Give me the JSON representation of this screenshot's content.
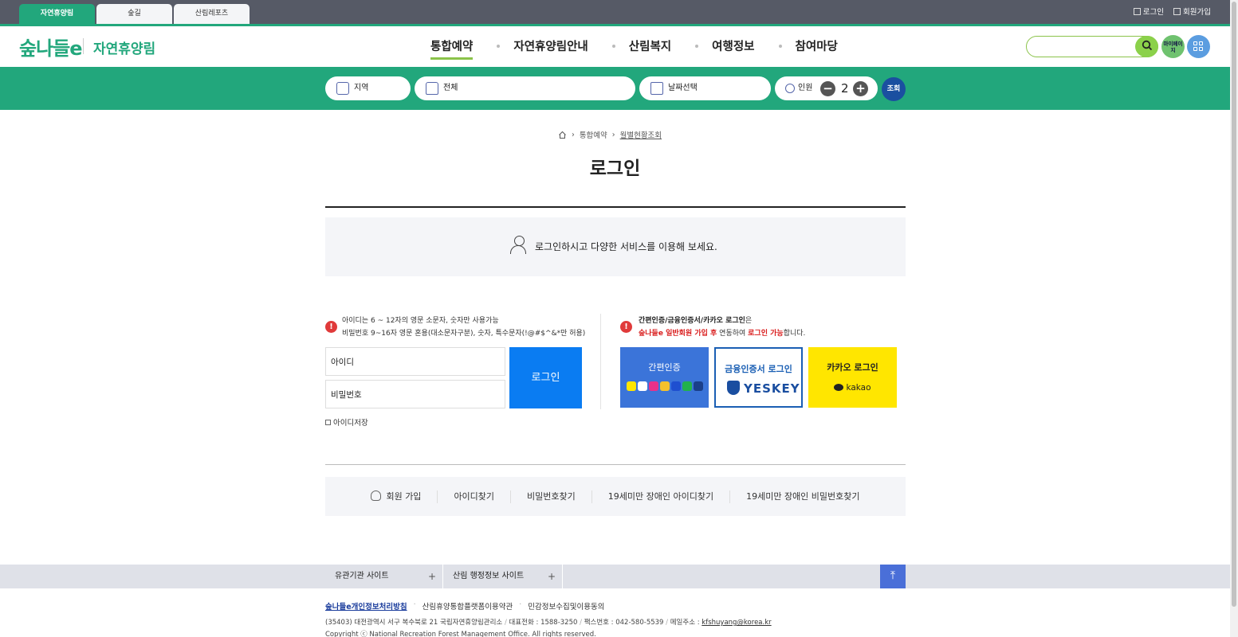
{
  "topbar": {
    "tabs": [
      "자연휴양림",
      "숲길",
      "산림레포츠"
    ],
    "login": "로그인",
    "join": "회원가입"
  },
  "header": {
    "logo": "숲나들e",
    "site_name": "자연휴양림",
    "nav": [
      "통합예약",
      "자연휴양림안내",
      "산림복지",
      "여행정보",
      "참여마당"
    ],
    "search_placeholder": "",
    "mypage": "마이페이지"
  },
  "searchbar": {
    "region": "지역",
    "facility": "전체",
    "date": "날짜선택",
    "people_label": "인원",
    "people_count": "2",
    "submit": "조회"
  },
  "breadcrumb": [
    "통합예약",
    "월별현황조회"
  ],
  "page_title": "로그인",
  "notice": "로그인하시고 다양한 서비스를 이용해 보세요.",
  "login_info": {
    "line1": "아이디는 6 ~ 12자의 영문 소문자, 숫자만 사용가능",
    "line2": "비밀번호 9~16자 영문 혼용(대소문자구분), 숫자, 특수문자(!@#$^&*만 허용)"
  },
  "easy_info": {
    "bold1": "간편인증/금융인증서/카카오 로그인",
    "text1": "은",
    "red1": "숲나들e 일반회원 가입 후",
    "text2": " 연동하여 ",
    "red2": "로그인 가능",
    "text3": "합니다."
  },
  "form": {
    "id_placeholder": "아이디",
    "pw_placeholder": "비밀번호",
    "login_button": "로그인",
    "save_id": "아이디저장"
  },
  "easy_login": {
    "simple": "간편인증",
    "cert": "금융인증서 로그인",
    "yeskey": "YESKEY",
    "kakao": "카카오 로그인",
    "kakao_logo": "kakao"
  },
  "bottom_links": [
    "회원 가입",
    "아이디찾기",
    "비밀번호찾기",
    "19세미만 장애인 아이디찾기",
    "19세미만 장애인 비밀번호찾기"
  ],
  "footer": {
    "related_sites": "유관기관 사이트",
    "admin_sites": "산림 행정정보 사이트",
    "links": [
      "숲나들e개인정보처리방침",
      "산림휴양통합플랫폼이용약관",
      "민감정보수집및이용동의"
    ],
    "address": "(35403) 대전광역시 서구 복수북로 21 국립자연휴양림관리소",
    "phone": "대표전화 : 1588-3250",
    "fax": "팩스번호 : 042-580-5539",
    "email_label": "메일주소 : ",
    "email": "kfshuyang@korea.kr",
    "copyright": "Copyright ⓒ National Recreation Forest Management Office. All rights reserved."
  },
  "colors": {
    "brand_green": "#22a77c",
    "login_blue": "#0a7cf2",
    "alert_red": "#e03a3a",
    "kakao_yellow": "#ffe600"
  }
}
